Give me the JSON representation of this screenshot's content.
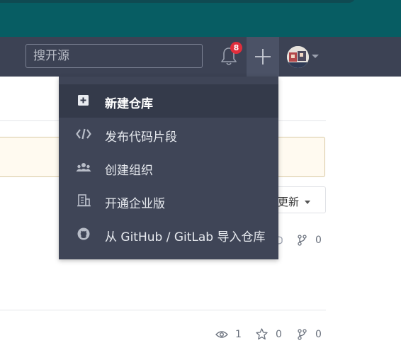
{
  "navbar": {
    "search_placeholder": "搜开源",
    "notification_count": "8"
  },
  "dropdown": {
    "items": [
      {
        "label": "新建仓库",
        "icon": "plus-square-icon",
        "active": true
      },
      {
        "label": "发布代码片段",
        "icon": "code-icon"
      },
      {
        "label": "创建组织",
        "icon": "group-icon"
      },
      {
        "label": "开通企业版",
        "icon": "building-icon"
      },
      {
        "label": "从 GitHub / GitLab 导入仓库",
        "icon": "github-icon"
      }
    ]
  },
  "content": {
    "sort_label": "更新",
    "row1": {
      "forks": "0"
    },
    "row2": {
      "watches": "1",
      "stars": "0",
      "forks": "0"
    }
  },
  "colors": {
    "topband": "#075d63",
    "navbar": "#3c4254",
    "dropdown": "#3f4557",
    "badge": "#e02e3c"
  }
}
